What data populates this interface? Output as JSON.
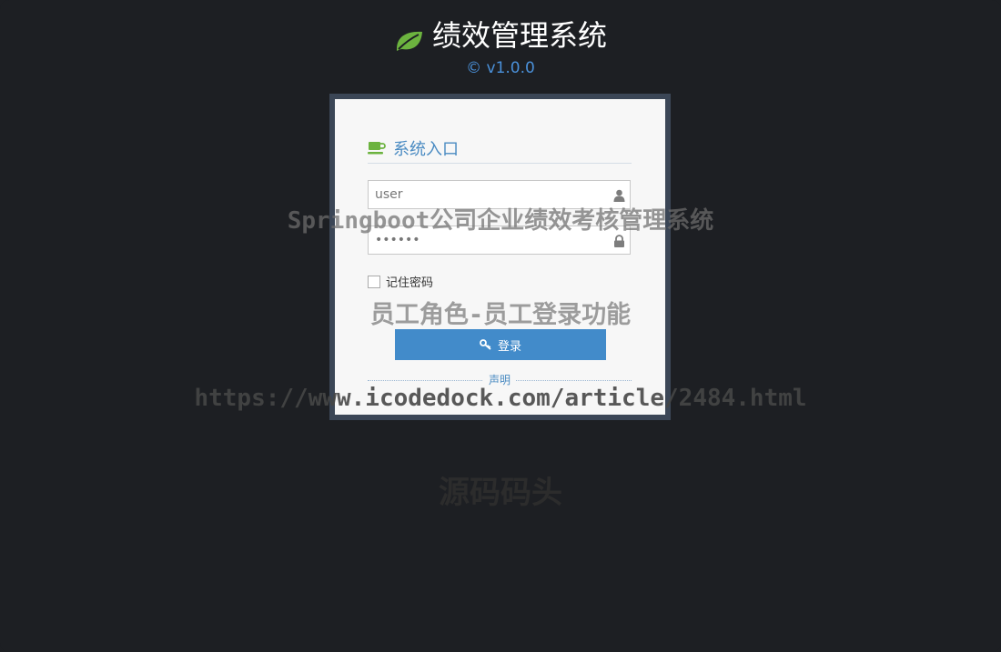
{
  "header": {
    "title": "绩效管理系统",
    "version": "© v1.0.0",
    "logo_icon": "leaf-icon",
    "logo_color": "#6cb33f"
  },
  "login": {
    "title": "系统入口",
    "title_icon": "coffee-icon",
    "username_value": "user",
    "username_icon": "user-icon",
    "password_value": "••••••",
    "password_icon": "lock-icon",
    "remember_label": "记住密码",
    "remember_checked": false,
    "submit_label": "登录",
    "submit_icon": "key-icon",
    "divider_label": "声明",
    "accent_color": "#428bca"
  },
  "watermarks": {
    "line1": "Springboot公司企业绩效考核管理系统",
    "line2": "员工角色-员工登录功能",
    "line3": "https://www.icodedock.com/article/2484.html",
    "line4": "源码码头"
  }
}
